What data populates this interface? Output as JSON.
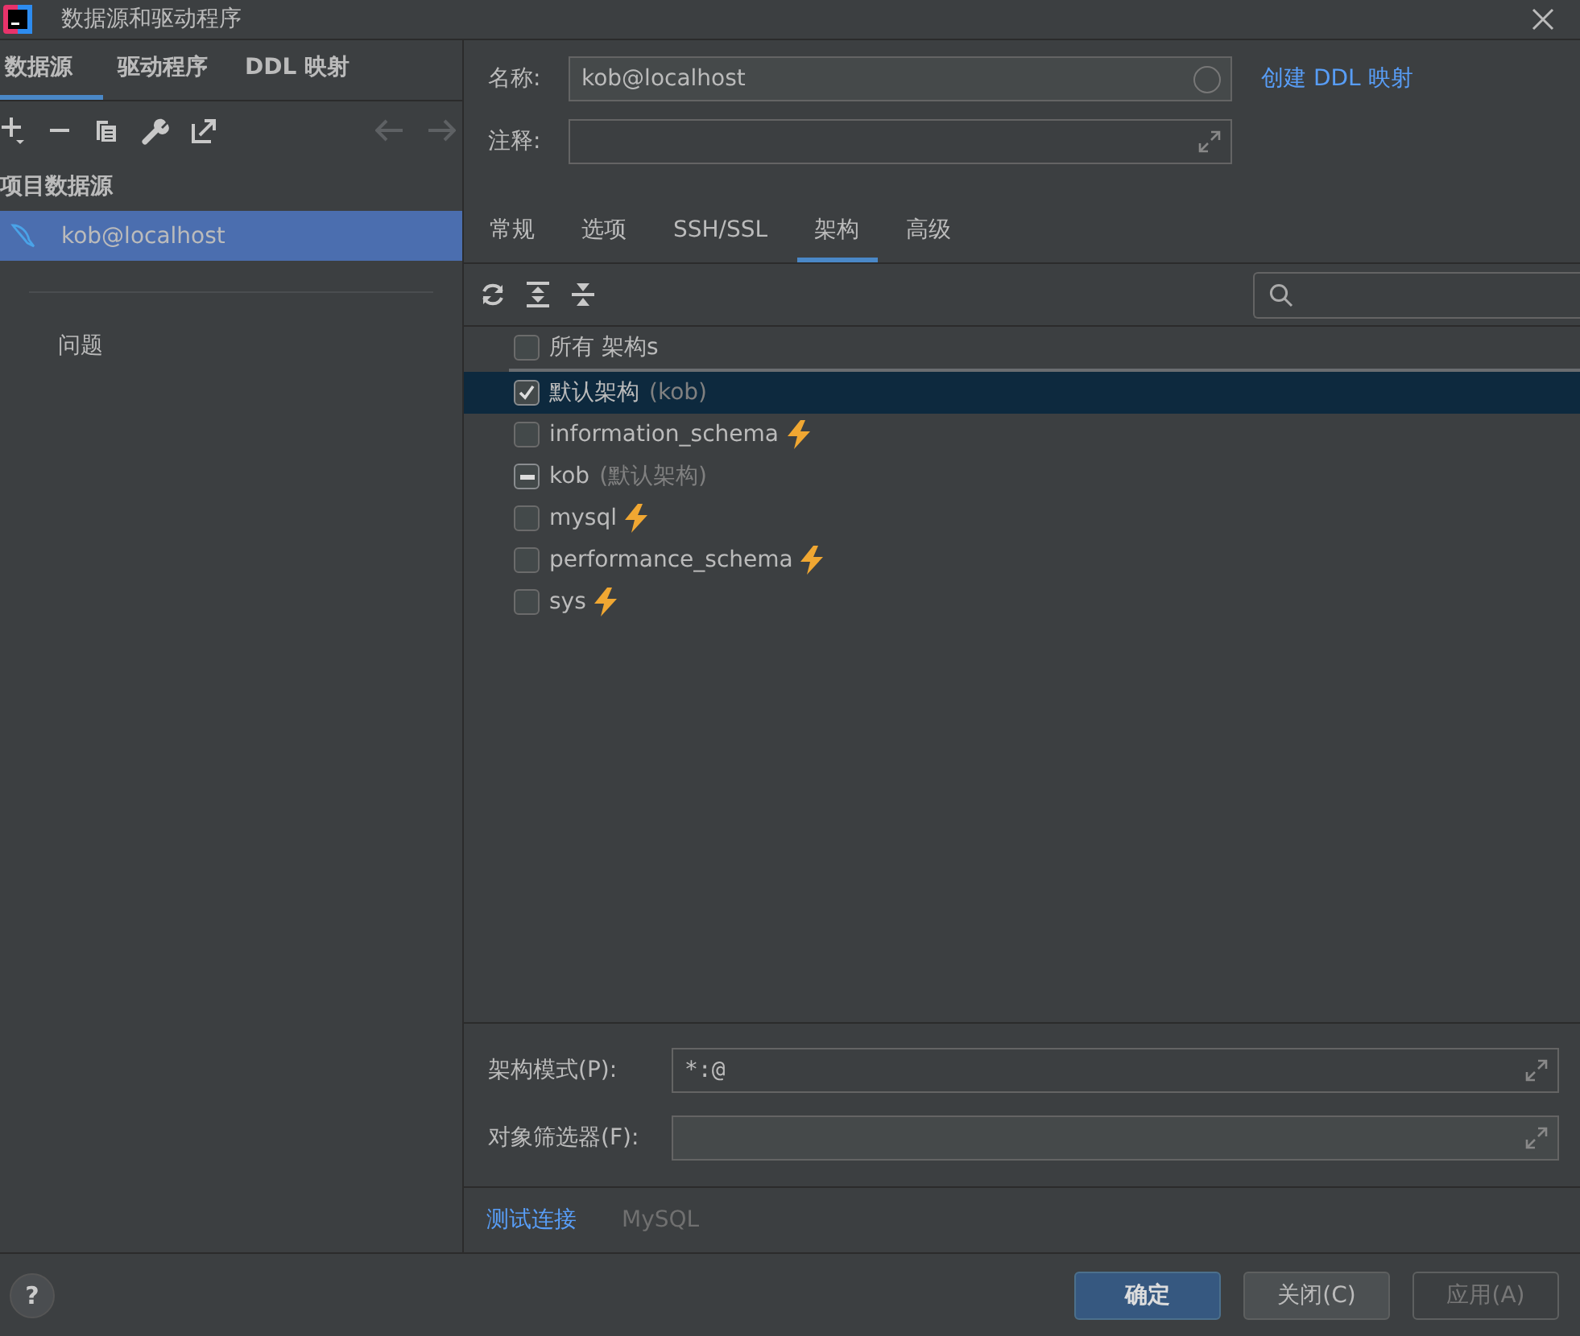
{
  "window": {
    "title": "数据源和驱动程序"
  },
  "sidebar": {
    "tabs": [
      {
        "label": "数据源",
        "selected": true
      },
      {
        "label": "驱动程序",
        "selected": false
      },
      {
        "label": "DDL 映射",
        "selected": false
      }
    ],
    "section_title": "项目数据源",
    "items": [
      {
        "label": "kob@localhost",
        "selected": true
      }
    ],
    "problems_label": "问题"
  },
  "form": {
    "name_label": "名称:",
    "name_value": "kob@localhost",
    "ddl_link": "创建 DDL 映射",
    "comment_label": "注释:"
  },
  "tabs": [
    {
      "label": "常规",
      "selected": false
    },
    {
      "label": "选项",
      "selected": false
    },
    {
      "label": "SSH/SSL",
      "selected": false
    },
    {
      "label": "架构",
      "selected": true
    },
    {
      "label": "高级",
      "selected": false
    }
  ],
  "schemas": [
    {
      "label": "所有 架构s",
      "checked": false,
      "mixed": false,
      "selected": false,
      "flash": false
    },
    {
      "label": "默认架构",
      "note": "(kob)",
      "checked": true,
      "mixed": false,
      "selected": true,
      "flash": false
    },
    {
      "label": "information_schema",
      "checked": false,
      "mixed": false,
      "selected": false,
      "flash": true
    },
    {
      "label": "kob",
      "note": "(默认架构)",
      "checked": true,
      "mixed": true,
      "selected": false,
      "flash": false
    },
    {
      "label": "mysql",
      "checked": false,
      "mixed": false,
      "selected": false,
      "flash": true
    },
    {
      "label": "performance_schema",
      "checked": false,
      "mixed": false,
      "selected": false,
      "flash": true
    },
    {
      "label": "sys",
      "checked": false,
      "mixed": false,
      "selected": false,
      "flash": true
    }
  ],
  "pattern": {
    "label": "架构模式(P):",
    "value": "*:@"
  },
  "filter": {
    "label": "对象筛选器(F):"
  },
  "footer": {
    "test_link": "测试连接",
    "driver": "MySQL"
  },
  "buttons": [
    {
      "label": "确定",
      "kind": "primary",
      "disabled": false
    },
    {
      "label": "关闭(C)",
      "kind": "normal",
      "disabled": false
    },
    {
      "label": "应用(A)",
      "kind": "normal",
      "disabled": true
    }
  ],
  "help": "?"
}
